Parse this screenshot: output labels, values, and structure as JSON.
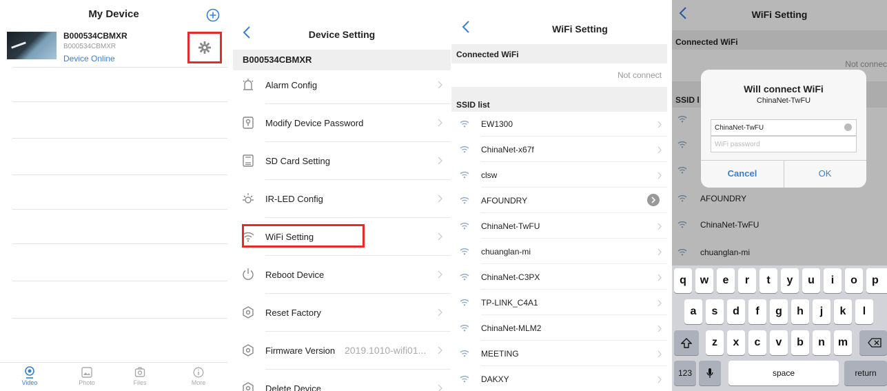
{
  "my_device": {
    "title": "My Device",
    "device": {
      "name": "B000534CBMXR",
      "id": "B000534CBMXR",
      "status": "Device Online"
    },
    "tabs": [
      {
        "label": "Video",
        "icon": "video-icon"
      },
      {
        "label": "Photo",
        "icon": "photo-icon"
      },
      {
        "label": "Files",
        "icon": "files-icon"
      },
      {
        "label": "More",
        "icon": "more-info-icon"
      }
    ],
    "accent_color": "#3a7fd0",
    "highlight_color": "#e52b2b"
  },
  "device_setting": {
    "title": "Device Setting",
    "device_id": "B000534CBMXR",
    "items": [
      {
        "label": "Alarm Config",
        "icon": "alarm-icon",
        "value": ""
      },
      {
        "label": "Modify Device Password",
        "icon": "lock-icon",
        "value": ""
      },
      {
        "label": "SD Card Setting",
        "icon": "sd-card-icon",
        "value": ""
      },
      {
        "label": "IR-LED Config",
        "icon": "sun-icon",
        "value": ""
      },
      {
        "label": "WiFi Setting",
        "icon": "wifi-icon",
        "value": ""
      },
      {
        "label": "Reboot Device",
        "icon": "power-icon",
        "value": ""
      },
      {
        "label": "Reset Factory",
        "icon": "gear-icon",
        "value": ""
      },
      {
        "label": "Firmware Version",
        "icon": "gear-icon",
        "value": "2019.1010-wifi01..."
      },
      {
        "label": "Delete Device",
        "icon": "gear-icon",
        "value": ""
      }
    ]
  },
  "wifi_setting": {
    "title": "WiFi Setting",
    "connected_header": "Connected WiFi",
    "connected_status": "Not connect",
    "ssid_header": "SSID list",
    "ssids": [
      "EW1300",
      "ChinaNet-x67f",
      "clsw",
      "AFOUNDRY",
      "ChinaNet-TwFU",
      "chuanglan-mi",
      "ChinaNet-C3PX",
      "TP-LINK_C4A1",
      "ChinaNet-MLM2",
      "MEETING",
      "DAKXY"
    ]
  },
  "wifi_dialog": {
    "title": "WiFi Setting",
    "connected_header": "Connected WiFi",
    "connected_status": "Not connec",
    "ssid_header": "SSID l",
    "visible_rows": [
      "AFOUNDRY",
      "ChinaNet-TwFU",
      "chuanglan-mi"
    ],
    "dialog": {
      "title": "Will connect WiFi",
      "subtitle": "ChinaNet-TwFU",
      "ssid_value": "ChinaNet-TwFU",
      "password_placeholder": "WiFi password",
      "cancel": "Cancel",
      "ok": "OK"
    },
    "keyboard": {
      "row1": [
        "q",
        "w",
        "e",
        "r",
        "t",
        "y",
        "u",
        "i",
        "o",
        "p"
      ],
      "row2": [
        "a",
        "s",
        "d",
        "f",
        "g",
        "h",
        "j",
        "k",
        "l"
      ],
      "row3": [
        "z",
        "x",
        "c",
        "v",
        "b",
        "n",
        "m"
      ],
      "numbers": "123",
      "space": "space",
      "return": "return"
    }
  }
}
